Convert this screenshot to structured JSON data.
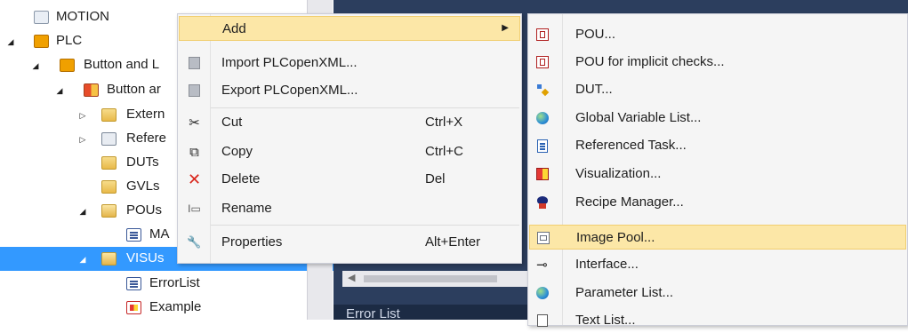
{
  "tree": {
    "items": [
      {
        "label": "MOTION",
        "icon": "motion-icon"
      },
      {
        "label": "PLC",
        "icon": "plc-icon"
      },
      {
        "label": "Button and L",
        "icon": "plc-project-icon"
      },
      {
        "label": "Button ar",
        "icon": "project-icon"
      },
      {
        "label": "Extern",
        "icon": "folder-icon"
      },
      {
        "label": "Refere",
        "icon": "references-icon"
      },
      {
        "label": "DUTs",
        "icon": "folder-icon"
      },
      {
        "label": "GVLs",
        "icon": "folder-icon"
      },
      {
        "label": "POUs",
        "icon": "folder-open-icon"
      },
      {
        "label": "MA",
        "icon": "program-icon"
      },
      {
        "label": "VISUs",
        "icon": "folder-open-icon"
      },
      {
        "label": "ErrorList",
        "icon": "program-icon"
      },
      {
        "label": "Example",
        "icon": "visualization-icon"
      }
    ],
    "selected": "VISUs"
  },
  "bottom_panel": {
    "error_tab": "Error List"
  },
  "context_menu": {
    "items": [
      {
        "label": "Add",
        "shortcut": "",
        "icon": "",
        "submenu_arrow": "▶"
      },
      {
        "label": "Import PLCopenXML...",
        "shortcut": "",
        "icon": "import-xml-icon"
      },
      {
        "label": "Export PLCopenXML...",
        "shortcut": "",
        "icon": "export-xml-icon"
      },
      {
        "label": "Cut",
        "shortcut": "Ctrl+X",
        "icon": "cut-icon",
        "glyph": "✂"
      },
      {
        "label": "Copy",
        "shortcut": "Ctrl+C",
        "icon": "copy-icon",
        "glyph": "⧉"
      },
      {
        "label": "Delete",
        "shortcut": "Del",
        "icon": "delete-icon",
        "glyph": "✕"
      },
      {
        "label": "Rename",
        "shortcut": "",
        "icon": "rename-icon",
        "glyph": "I▭"
      },
      {
        "label": "Properties",
        "shortcut": "Alt+Enter",
        "icon": "properties-icon",
        "glyph": "🔧"
      }
    ]
  },
  "add_submenu": {
    "items": [
      {
        "label": "POU...",
        "icon": "pou-icon"
      },
      {
        "label": "POU for implicit checks...",
        "icon": "pou-implicit-icon"
      },
      {
        "label": "DUT...",
        "icon": "dut-icon"
      },
      {
        "label": "Global Variable List...",
        "icon": "global-variable-list-icon"
      },
      {
        "label": "Referenced Task...",
        "icon": "referenced-task-icon"
      },
      {
        "label": "Visualization...",
        "icon": "visualization-icon"
      },
      {
        "label": "Recipe Manager...",
        "icon": "recipe-manager-icon"
      },
      {
        "label": "Image Pool...",
        "icon": "image-pool-icon"
      },
      {
        "label": "Interface...",
        "icon": "interface-icon",
        "glyph": "⊸"
      },
      {
        "label": "Parameter List...",
        "icon": "parameter-list-icon"
      },
      {
        "label": "Text List...",
        "icon": "text-list-icon"
      }
    ],
    "highlighted": "Image Pool..."
  },
  "colors": {
    "selection": "#3399ff",
    "menu_highlight": "#fce7a7",
    "dark_panel": "#2c3e5e",
    "delete_red": "#d9261c"
  }
}
